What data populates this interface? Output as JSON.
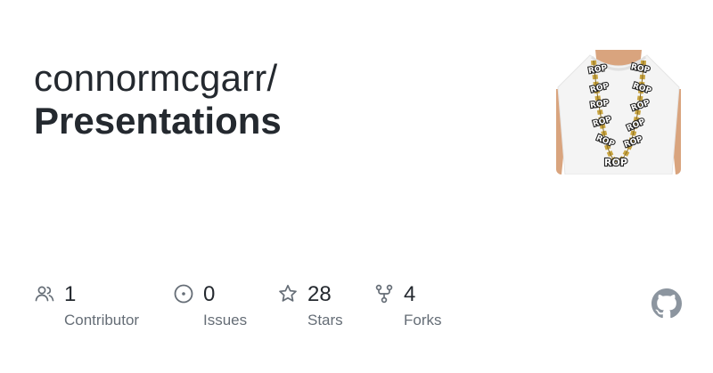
{
  "header": {
    "owner": "connormcgarr/",
    "repo": "Presentations"
  },
  "avatar": {
    "labels": [
      "ROP",
      "ROP",
      "ROP",
      "ROP",
      "ROP",
      "ROP",
      "ROP",
      "ROP",
      "ROP",
      "ROP",
      "ROP"
    ]
  },
  "stats": {
    "contributors": {
      "value": "1",
      "label": "Contributor",
      "icon": "people-icon"
    },
    "issues": {
      "value": "0",
      "label": "Issues",
      "icon": "issue-opened-icon"
    },
    "stars": {
      "value": "28",
      "label": "Stars",
      "icon": "star-icon"
    },
    "forks": {
      "value": "4",
      "label": "Forks",
      "icon": "repo-forked-icon"
    }
  },
  "colors": {
    "text": "#24292f",
    "muted": "#656d76"
  }
}
